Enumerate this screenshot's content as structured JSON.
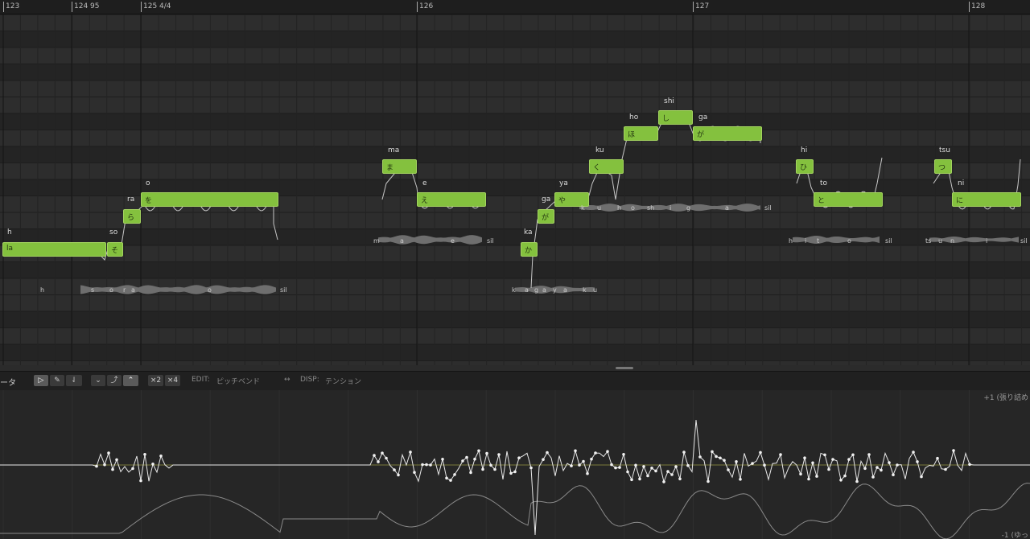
{
  "ruler": {
    "markers": [
      {
        "label": "123"
      },
      {
        "label": "124   95"
      },
      {
        "label": "125  4/4"
      },
      {
        "label": "126"
      },
      {
        "label": "127"
      },
      {
        "label": "128"
      }
    ]
  },
  "notes": [
    {
      "lyric": "h",
      "kana": "la"
    },
    {
      "lyric": "so",
      "kana": "そ"
    },
    {
      "lyric": "ra",
      "kana": "ら"
    },
    {
      "lyric": "o",
      "kana": "を"
    },
    {
      "lyric": "ma",
      "kana": "ま"
    },
    {
      "lyric": "e",
      "kana": "え"
    },
    {
      "lyric": "ka",
      "kana": "か"
    },
    {
      "lyric": "ga",
      "kana": "が"
    },
    {
      "lyric": "ya",
      "kana": "や"
    },
    {
      "lyric": "ku",
      "kana": "く"
    },
    {
      "lyric": "ho",
      "kana": "ほ"
    },
    {
      "lyric": "shi",
      "kana": "し"
    },
    {
      "lyric": "ga",
      "kana": "が"
    },
    {
      "lyric": "hi",
      "kana": "ひ"
    },
    {
      "lyric": "to",
      "kana": "と"
    },
    {
      "lyric": "tsu",
      "kana": "つ"
    },
    {
      "lyric": "ni",
      "kana": "に"
    }
  ],
  "phonemes": {
    "p1": [
      "h",
      "s",
      "o",
      "r",
      "a",
      "o",
      "sil"
    ],
    "p2": [
      "m",
      "a",
      "e",
      "sil"
    ],
    "p3": [
      "k",
      "a",
      "g",
      "a",
      "y",
      "a",
      "k",
      "u"
    ],
    "p4": [
      "k",
      "u",
      "h",
      "o",
      "sh",
      "i",
      "g",
      "a",
      "sil"
    ],
    "p5": [
      "h",
      "i",
      "t",
      "o",
      "sil"
    ],
    "p6": [
      "ts",
      "u",
      "n",
      "i",
      "sil"
    ]
  },
  "toolbar": {
    "title": "ータ",
    "tools": [
      "▷",
      "✎",
      "⇃"
    ],
    "shapes": [
      "⌄",
      "⤴",
      "⌃"
    ],
    "zoom": [
      "×2",
      "×4"
    ],
    "edit_label": "EDIT:",
    "edit_value": "ピッチベンド",
    "arrows": "↔",
    "disp_label": "DISP:",
    "disp_value": "テンション"
  },
  "editor": {
    "top_label": "+1 (張り詰め",
    "bottom_label": "-1 (ゆっ"
  },
  "colors": {
    "note_fill": "#84c13e",
    "pitch_curve": "#c6c6c6",
    "param_line": "#e8e8e8"
  }
}
